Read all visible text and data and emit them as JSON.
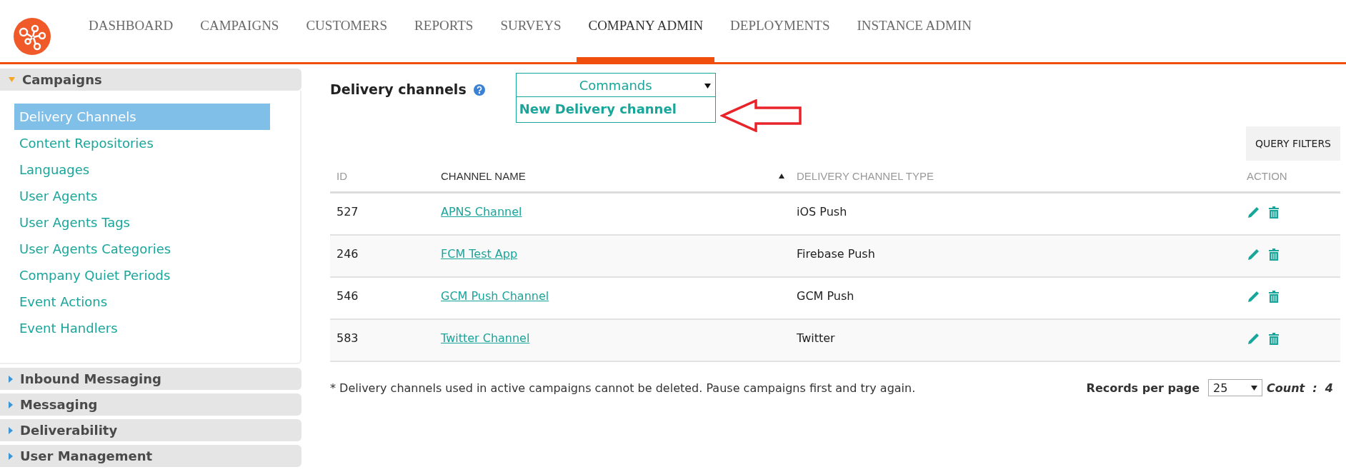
{
  "nav": {
    "items": [
      {
        "label": "DASHBOARD",
        "selected": false
      },
      {
        "label": "CAMPAIGNS",
        "selected": false
      },
      {
        "label": "CUSTOMERS",
        "selected": false
      },
      {
        "label": "REPORTS",
        "selected": false
      },
      {
        "label": "SURVEYS",
        "selected": false
      },
      {
        "label": "COMPANY ADMIN",
        "selected": true
      },
      {
        "label": "DEPLOYMENTS",
        "selected": false
      },
      {
        "label": "INSTANCE ADMIN",
        "selected": false
      }
    ]
  },
  "sidebar": {
    "sections": [
      {
        "title": "Campaigns",
        "expanded": true,
        "items": [
          {
            "label": "Delivery Channels",
            "selected": true
          },
          {
            "label": "Content Repositories",
            "selected": false
          },
          {
            "label": "Languages",
            "selected": false
          },
          {
            "label": "User Agents",
            "selected": false
          },
          {
            "label": "User Agents Tags",
            "selected": false
          },
          {
            "label": "User Agents Categories",
            "selected": false
          },
          {
            "label": "Company Quiet Periods",
            "selected": false
          },
          {
            "label": "Event Actions",
            "selected": false
          },
          {
            "label": "Event Handlers",
            "selected": false
          }
        ]
      },
      {
        "title": "Inbound Messaging",
        "expanded": false
      },
      {
        "title": "Messaging",
        "expanded": false
      },
      {
        "title": "Deliverability",
        "expanded": false
      },
      {
        "title": "User Management",
        "expanded": false
      }
    ]
  },
  "page": {
    "title": "Delivery channels",
    "commands": {
      "label": "Commands",
      "expanded": true,
      "options": [
        "New Delivery channel"
      ]
    },
    "query_filters": "QUERY FILTERS"
  },
  "table": {
    "columns": [
      {
        "label": "ID",
        "sorted": false
      },
      {
        "label": "CHANNEL NAME",
        "sorted": true
      },
      {
        "label": "DELIVERY CHANNEL TYPE",
        "sorted": false
      },
      {
        "label": "ACTION",
        "sorted": false
      }
    ],
    "rows": [
      {
        "id": "527",
        "name": "APNS Channel",
        "type": "iOS Push"
      },
      {
        "id": "246",
        "name": "FCM Test App",
        "type": "Firebase Push"
      },
      {
        "id": "546",
        "name": "GCM Push Channel",
        "type": "GCM Push"
      },
      {
        "id": "583",
        "name": "Twitter Channel",
        "type": "Twitter"
      }
    ]
  },
  "footer": {
    "note": "* Delivery channels used in active campaigns cannot be deleted. Pause campaigns first and try again.",
    "records_label": "Records per page",
    "records_value": "25",
    "count_label": "Count",
    "count_separator": ":",
    "count_value": "4"
  }
}
